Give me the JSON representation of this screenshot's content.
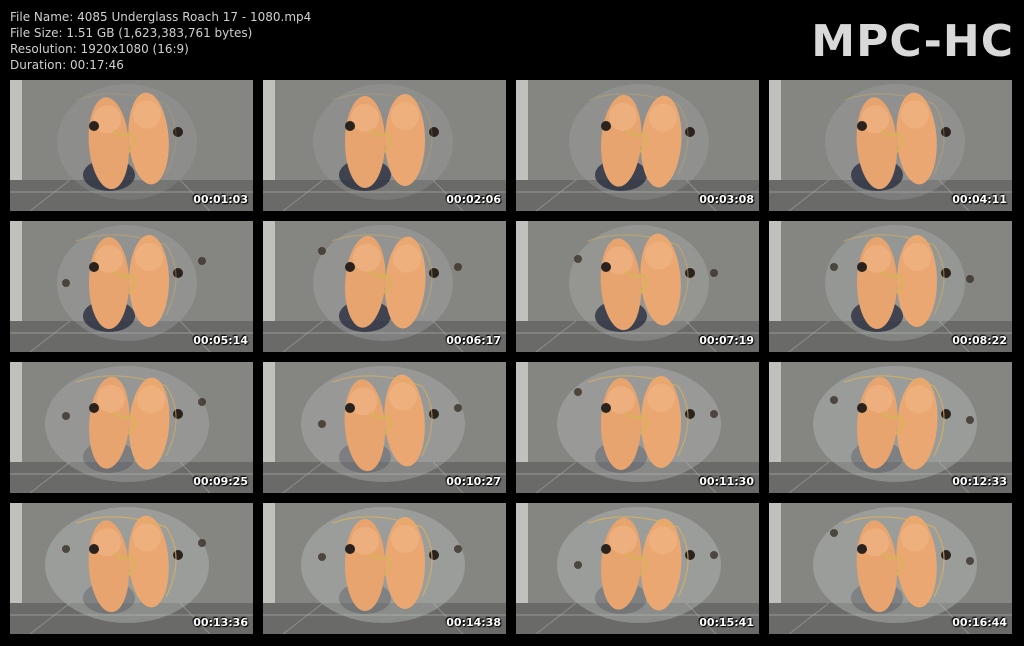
{
  "info": {
    "file_name": "File Name: 4085 Underglass Roach 17 - 1080.mp4",
    "file_size": "File Size: 1.51 GB (1,623,383,761 bytes)",
    "resolution": "Resolution: 1920x1080 (16:9)",
    "duration": "Duration: 00:17:46"
  },
  "logo": "MPC-HC",
  "thumbnails": [
    {
      "timestamp": "00:01:03"
    },
    {
      "timestamp": "00:02:06"
    },
    {
      "timestamp": "00:03:08"
    },
    {
      "timestamp": "00:04:11"
    },
    {
      "timestamp": "00:05:14"
    },
    {
      "timestamp": "00:06:17"
    },
    {
      "timestamp": "00:07:19"
    },
    {
      "timestamp": "00:08:22"
    },
    {
      "timestamp": "00:09:25"
    },
    {
      "timestamp": "00:10:27"
    },
    {
      "timestamp": "00:11:30"
    },
    {
      "timestamp": "00:12:33"
    },
    {
      "timestamp": "00:13:36"
    },
    {
      "timestamp": "00:14:38"
    },
    {
      "timestamp": "00:15:41"
    },
    {
      "timestamp": "00:16:44"
    }
  ],
  "colors": {
    "background": "#000000",
    "text": "#d0d0d0",
    "skin": "#e8a46e",
    "residue": "#d9b15a"
  }
}
